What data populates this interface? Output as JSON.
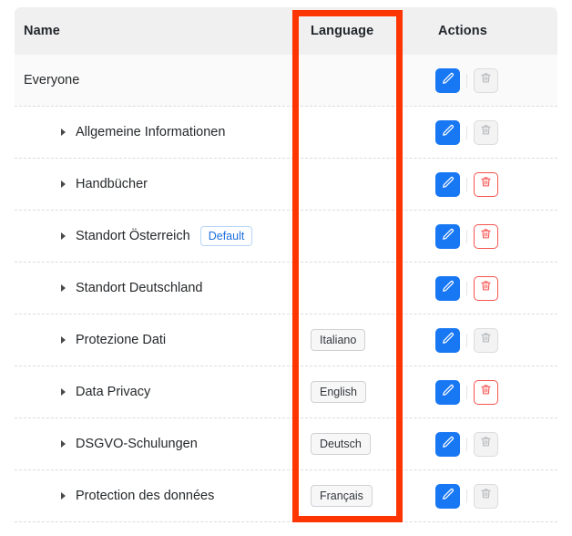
{
  "table": {
    "columns": [
      {
        "key": "name",
        "label": "Name"
      },
      {
        "key": "language",
        "label": "Language"
      },
      {
        "key": "actions",
        "label": "Actions"
      }
    ],
    "rows": [
      {
        "name": "Everyone",
        "indent": false,
        "default_badge": "",
        "language": "",
        "edit_label": "edit-icon",
        "delete_enabled": false
      },
      {
        "name": "Allgemeine Informationen",
        "indent": true,
        "default_badge": "",
        "language": "",
        "edit_label": "edit-icon",
        "delete_enabled": false
      },
      {
        "name": "Handbücher",
        "indent": true,
        "default_badge": "",
        "language": "",
        "edit_label": "edit-icon",
        "delete_enabled": true
      },
      {
        "name": "Standort Österreich",
        "indent": true,
        "default_badge": "Default",
        "language": "",
        "edit_label": "edit-icon",
        "delete_enabled": true
      },
      {
        "name": "Standort Deutschland",
        "indent": true,
        "default_badge": "",
        "language": "",
        "edit_label": "edit-icon",
        "delete_enabled": true
      },
      {
        "name": "Protezione Dati",
        "indent": true,
        "default_badge": "",
        "language": "Italiano",
        "edit_label": "edit-icon",
        "delete_enabled": false
      },
      {
        "name": "Data Privacy",
        "indent": true,
        "default_badge": "",
        "language": "English",
        "edit_label": "edit-icon",
        "delete_enabled": true
      },
      {
        "name": "DSGVO-Schulungen",
        "indent": true,
        "default_badge": "",
        "language": "Deutsch",
        "edit_label": "edit-icon",
        "delete_enabled": false
      },
      {
        "name": "Protection des données",
        "indent": true,
        "default_badge": "",
        "language": "Français",
        "edit_label": "edit-icon",
        "delete_enabled": false
      }
    ]
  },
  "annotation": {
    "target_column": "Language",
    "color": "#fc3503"
  },
  "colors": {
    "header_bg": "#f0f0f1",
    "edit_blue": "#1877f2",
    "delete_red": "#f5534f",
    "badge_blue": "#1d6fe0",
    "row_tint": "#fafafa"
  }
}
